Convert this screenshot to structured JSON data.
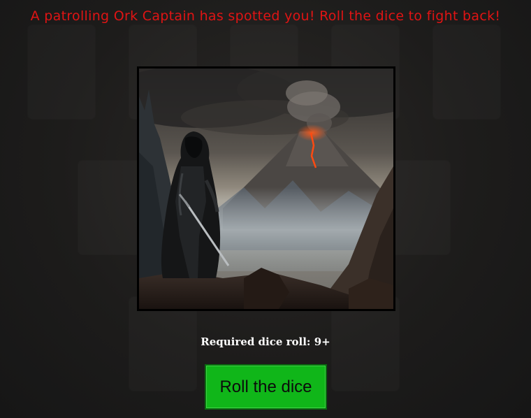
{
  "encounter": {
    "message": "A patrolling Ork Captain has spotted you! Roll the dice to fight back!",
    "required_roll_text": "Required dice roll: 9+",
    "required_roll_value": 9
  },
  "actions": {
    "roll_label": "Roll the dice"
  },
  "scene": {
    "subject": "hooded-warrior-volcano-landscape"
  },
  "colors": {
    "headline": "#e01414",
    "button": "#10b619",
    "background": "#1c1c1c"
  }
}
